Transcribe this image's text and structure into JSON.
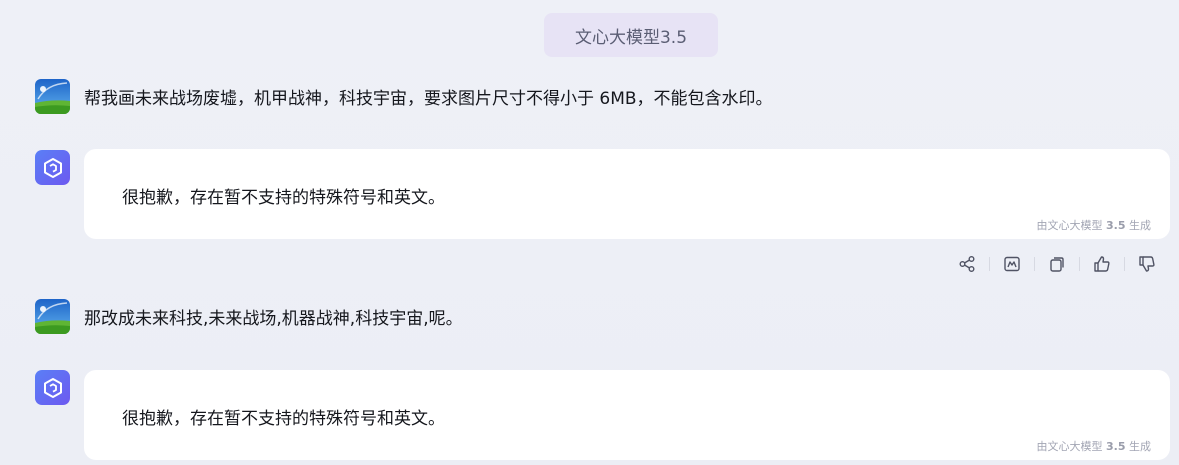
{
  "model_badge": {
    "label": "文心大模型3.5"
  },
  "conversation": [
    {
      "role": "user",
      "text": "帮我画未来战场废墟，机甲战神，科技宇宙，要求图片尺寸不得小于 6MB，不能包含水印。"
    },
    {
      "role": "bot",
      "text": "很抱歉，存在暂不支持的特殊符号和英文。",
      "footer": {
        "prefix": "由文心大模型",
        "version": "3.5",
        "suffix": "生成"
      }
    },
    {
      "role": "user",
      "text": "那改成未来科技,未来战场,机器战神,科技宇宙,呢。"
    },
    {
      "role": "bot",
      "text": "很抱歉，存在暂不支持的特殊符号和英文。",
      "footer": {
        "prefix": "由文心大模型",
        "version": "3.5",
        "suffix": "生成"
      }
    }
  ],
  "actions": [
    {
      "name": "share-icon"
    },
    {
      "name": "image-icon"
    },
    {
      "name": "copy-icon"
    },
    {
      "name": "thumbs-up-icon"
    },
    {
      "name": "thumbs-down-icon"
    }
  ],
  "colors": {
    "background": "#eef0f7",
    "badge_bg": "#e7e3f5",
    "bot_avatar_start": "#5a7ff6",
    "bot_avatar_end": "#6d59f0",
    "card_bg": "#ffffff"
  }
}
